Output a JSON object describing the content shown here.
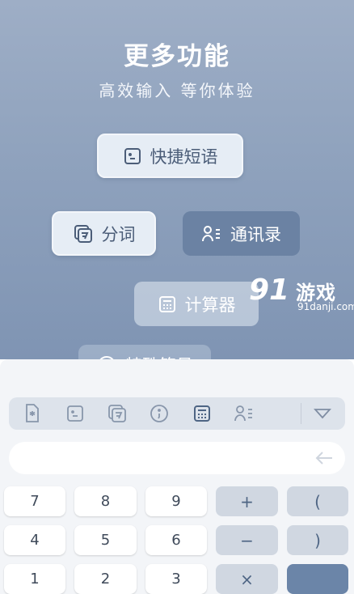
{
  "promo": {
    "title": "更多功能",
    "subtitle": "高效输入 等你体验",
    "chips": {
      "quick_phrase": "快捷短语",
      "word_split": "分词",
      "contacts": "通讯录",
      "calculator": "计算器",
      "special_symbols": "特殊符号"
    },
    "watermark": {
      "logo": "91",
      "name": "游戏",
      "domain": "91danji.com"
    }
  },
  "keyboard": {
    "toolbar_icons": [
      "sim-card-icon",
      "phrase-icon",
      "split-icon",
      "symbol-icon",
      "calculator-icon",
      "contacts-icon",
      "collapse-icon"
    ],
    "input": {
      "value": ""
    },
    "keys": {
      "row1": [
        "7",
        "8",
        "9",
        "+",
        "("
      ],
      "row2": [
        "4",
        "5",
        "6",
        "−",
        ")"
      ],
      "row3": [
        "1",
        "2",
        "3",
        "×",
        ""
      ]
    }
  },
  "colors": {
    "accent": "#6b85a8",
    "promo_bg": "#8fa2bd",
    "keyboard_bg": "#f3f5f8"
  }
}
